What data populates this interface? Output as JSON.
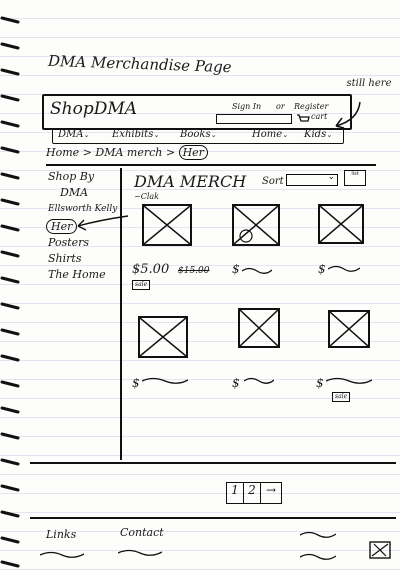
{
  "page_title": "DMA Merchandise Page",
  "note": "still here",
  "header": {
    "logo": "ShopDMA",
    "sign_in": "Sign In",
    "or_text": "or",
    "register": "Register",
    "cart": "cart"
  },
  "nav": [
    {
      "label": "DMA"
    },
    {
      "label": "Exhibits"
    },
    {
      "label": "Books"
    },
    {
      "label": "Home"
    },
    {
      "label": "Kids"
    }
  ],
  "breadcrumb": {
    "home": "Home",
    "sep1": ">",
    "section": "DMA merch",
    "sep2": ">",
    "current": "Her"
  },
  "sidebar": {
    "title": "Shop By",
    "items": [
      {
        "label": "DMA"
      },
      {
        "label": "Ellsworth Kelly"
      },
      {
        "label": "Her"
      },
      {
        "label": "Posters"
      },
      {
        "label": "Shirts"
      },
      {
        "label": "The Home"
      }
    ]
  },
  "main": {
    "heading": "DMA MERCH",
    "subheading": "~Clak",
    "sort_label": "Sort",
    "grid_icon_text": "list"
  },
  "products": [
    {
      "price": "$5.00",
      "old_price": "$15.00",
      "badge": "sale"
    },
    {
      "price": "$"
    },
    {
      "price": "$"
    },
    {
      "price": "$"
    },
    {
      "price": "$"
    },
    {
      "price": "$",
      "badge": "sale"
    }
  ],
  "pagination": [
    "1",
    "2",
    "→"
  ],
  "footer": {
    "links": "Links",
    "contact": "Contact"
  }
}
